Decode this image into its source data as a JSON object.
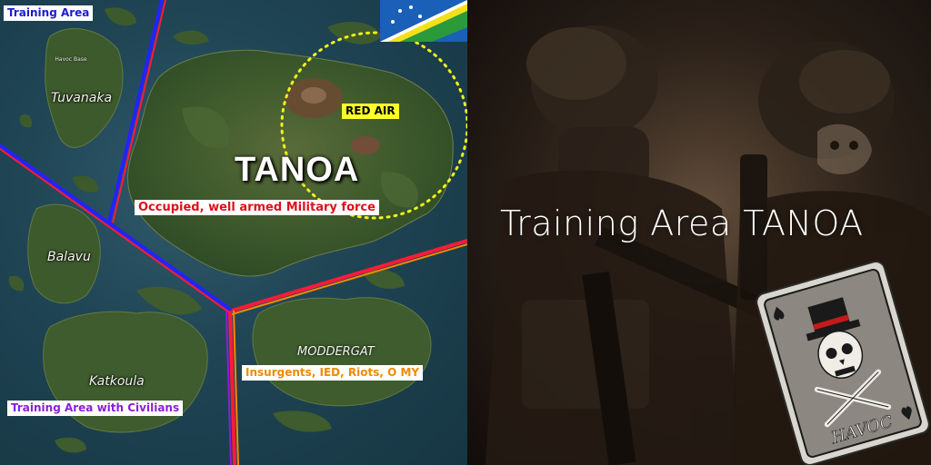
{
  "map": {
    "tags": {
      "training_area": "Training Area",
      "occupied": "Occupied, well armed Military force",
      "red_air": "RED AIR",
      "insurgents": "Insurgents, IED, Riots, O MY",
      "civilians": "Training Area with Civilians"
    },
    "title": "TANOA",
    "islands": {
      "tuvanaka": "Tuvanaka",
      "havoc_base": "Havoc Base",
      "balavu": "Balavu",
      "katkoula": "Katkoula",
      "moddergat": "MODDERGAT"
    },
    "colors": {
      "blue": "#1b1bd6",
      "red": "#e0101a",
      "orange": "#f08a00",
      "purple": "#8a1fd8",
      "yellow": "#ffff2a"
    }
  },
  "panel": {
    "title": "Training Area TANOA",
    "card_text": "HAVOC",
    "card_suit_icon": "spade-icon"
  }
}
